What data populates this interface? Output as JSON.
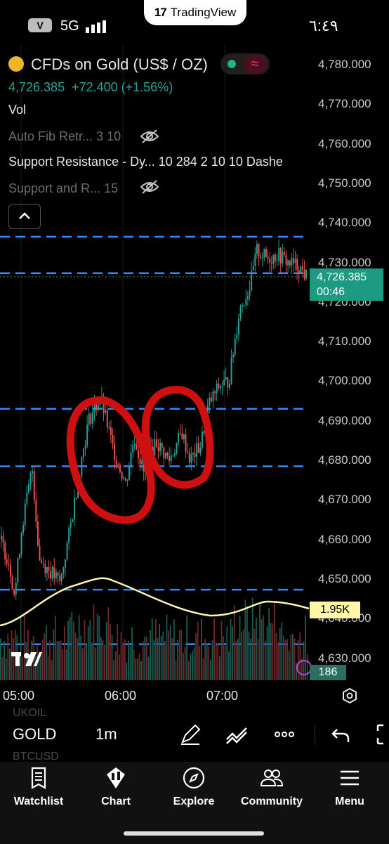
{
  "status_bar": {
    "carrier_badge": "V",
    "network": "5G",
    "time": "٦:٤٩",
    "pill": "TradingView"
  },
  "symbol": {
    "name": "CFDs on Gold (US$ / OZ)",
    "price": "4,726.385",
    "change": "+72.400 (+1.56%)"
  },
  "indicators": {
    "vol": "Vol",
    "auto_fib": "Auto Fib Retr...  3 10",
    "support_resistance": "Support Resistance - Dy...  10 284 2 10 10 Dashe",
    "support_and_r": "Support and R...  15"
  },
  "y_axis": {
    "ticks": [
      "4,780.000",
      "4,770.000",
      "4,760.000",
      "4,750.000",
      "4,740.000",
      "4,730.000",
      "4,720.000",
      "4,710.000",
      "4,700.000",
      "4,690.000",
      "4,680.000",
      "4,670.000",
      "4,660.000",
      "4,650.000",
      "4,640.000",
      "4,630.000"
    ]
  },
  "price_tag": {
    "price": "4,726.385",
    "countdown": "00:46"
  },
  "volume_tag": "1.95K",
  "volume_tag2": "186",
  "x_axis": {
    "ticks": [
      "05:00",
      "06:00",
      "07:00"
    ]
  },
  "toolbar": {
    "ghost_top": "UKOIL",
    "symbol": "GOLD",
    "ghost_bottom": "BTCUSD",
    "timeframe": "1m"
  },
  "bottom_nav": [
    {
      "label": "Watchlist",
      "icon": "watchlist-icon"
    },
    {
      "label": "Chart",
      "icon": "chart-icon"
    },
    {
      "label": "Explore",
      "icon": "compass-icon"
    },
    {
      "label": "Community",
      "icon": "community-icon"
    },
    {
      "label": "Menu",
      "icon": "menu-icon"
    }
  ],
  "colors": {
    "up": "#26a69a",
    "down": "#ef5350",
    "level": "#2a8cff",
    "ma": "#fff6a8",
    "annotation": "#d01010",
    "accent": "#1d9a82"
  }
}
